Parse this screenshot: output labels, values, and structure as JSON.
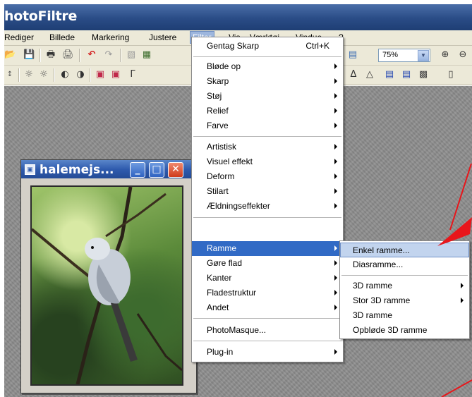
{
  "app": {
    "title": "hotoFiltre"
  },
  "menubar": {
    "items": [
      "Rediger",
      "Billede",
      "Markering",
      "Justere",
      "Filter",
      "Vis",
      "Værktøj",
      "Vindue",
      "?"
    ]
  },
  "toolbar": {
    "zoom_value": "75%"
  },
  "image_window": {
    "title": "halemejs..."
  },
  "filter_menu": {
    "repeat_label": "Gentag Skarp",
    "repeat_shortcut": "Ctrl+K",
    "items": [
      {
        "label": "Bløde op",
        "submenu": true
      },
      {
        "label": "Skarp",
        "submenu": true
      },
      {
        "label": "Støj",
        "submenu": true
      },
      {
        "label": "Relief",
        "submenu": true
      },
      {
        "label": "Farve",
        "submenu": true
      },
      {
        "label": "Artistisk",
        "submenu": true
      },
      {
        "label": "Visuel effekt",
        "submenu": true
      },
      {
        "label": "Deform",
        "submenu": true
      },
      {
        "label": "Stilart",
        "submenu": true
      },
      {
        "label": "Ældningseffekter",
        "submenu": true
      },
      {
        "label": "Ramme",
        "submenu": true,
        "highlighted": true
      },
      {
        "label": "Gøre flad",
        "submenu": true
      },
      {
        "label": "Kanter",
        "submenu": true
      },
      {
        "label": "Fladestruktur",
        "submenu": true
      },
      {
        "label": "Andet",
        "submenu": true
      },
      {
        "label": "PhotoMasque...",
        "submenu": false
      },
      {
        "label": "Plug-in",
        "submenu": true
      }
    ]
  },
  "ramme_submenu": {
    "items": [
      {
        "label": "Enkel ramme...",
        "hovered": true
      },
      {
        "label": "Diasramme..."
      },
      {
        "label": "3D ramme",
        "submenu": true
      },
      {
        "label": "Stor 3D ramme",
        "submenu": true
      },
      {
        "label": "3D ramme"
      },
      {
        "label": "Opbløde 3D ramme"
      }
    ]
  },
  "colors": {
    "highlight": "#316ac5",
    "hover": "#c2d4ee",
    "annotation_arrow": "#e8161b"
  }
}
